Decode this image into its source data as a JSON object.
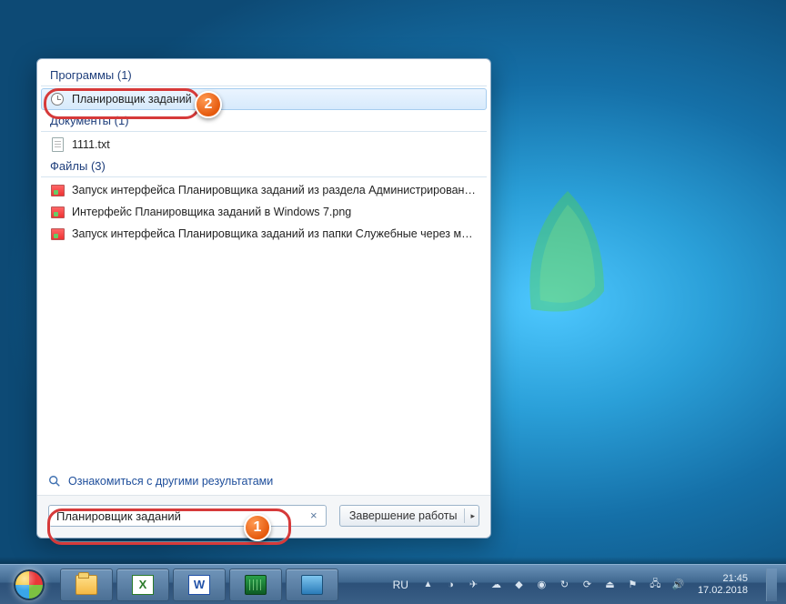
{
  "categories": {
    "programs": {
      "label": "Программы",
      "count": "(1)"
    },
    "documents": {
      "label": "Документы",
      "count": "(1)"
    },
    "files": {
      "label": "Файлы",
      "count": "(3)"
    }
  },
  "results": {
    "programs": [
      {
        "label": "Планировщик заданий"
      }
    ],
    "documents": [
      {
        "label": "1111.txt"
      }
    ],
    "files": [
      {
        "label": "Запуск интерфейса Планировщика заданий из раздела Администрирование..."
      },
      {
        "label": "Интерфейс Планировщика заданий в Windows 7.png"
      },
      {
        "label": "Запуск интерфейса Планировщика заданий из папки Служебные через мен..."
      }
    ]
  },
  "see_more": "Ознакомиться с другими результатами",
  "search": {
    "value": "Планировщик заданий",
    "clear": "×"
  },
  "shutdown": {
    "label": "Завершение работы",
    "arrow": "▸"
  },
  "taskbar": {
    "lang": "RU",
    "time": "21:45",
    "date": "17.02.2018"
  },
  "annotations": {
    "one": "1",
    "two": "2"
  }
}
